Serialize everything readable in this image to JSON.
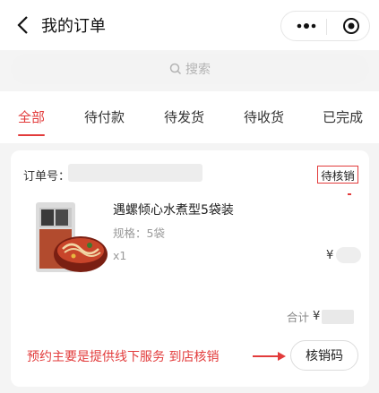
{
  "header": {
    "title": "我的订单",
    "back_icon": "chevron-left-icon",
    "more_icon": "more-dots-icon",
    "capsule_icon": "target-icon"
  },
  "search": {
    "placeholder": "搜索",
    "icon": "search-icon"
  },
  "tabs": [
    {
      "label": "全部",
      "active": true
    },
    {
      "label": "待付款",
      "active": false
    },
    {
      "label": "待发货",
      "active": false
    },
    {
      "label": "待收货",
      "active": false
    },
    {
      "label": "已完成",
      "active": false
    }
  ],
  "order": {
    "order_label": "订单号：",
    "status": "待核销",
    "product": {
      "name": "遇螺倾心水煮型5袋装",
      "spec": "规格：5袋",
      "qty": "x1",
      "price_prefix": "¥"
    },
    "total_label": "合计",
    "total_prefix": "¥",
    "note": "预约主要是提供线下服务 到店核销",
    "action_button": "核销码"
  },
  "colors": {
    "accent": "#e23b3b",
    "background": "#f4f4f4"
  }
}
